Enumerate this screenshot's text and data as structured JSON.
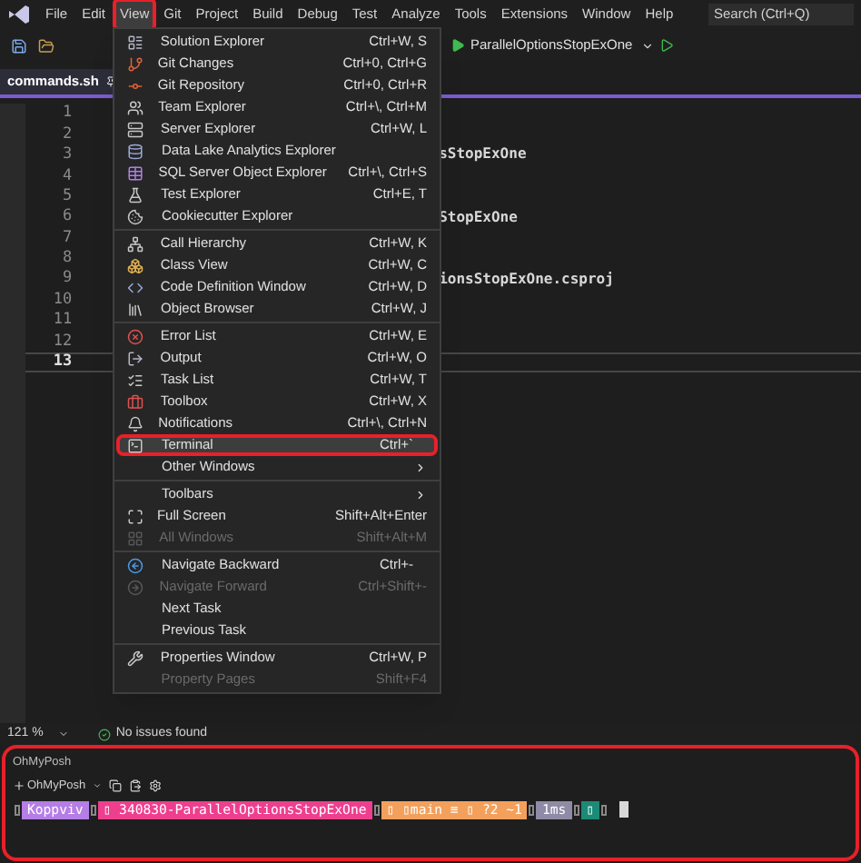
{
  "menu_bar": {
    "items": [
      {
        "label": "File",
        "selected": false
      },
      {
        "label": "Edit",
        "selected": false
      },
      {
        "label": "View",
        "selected": true
      },
      {
        "label": "Git",
        "selected": false
      },
      {
        "label": "Project",
        "selected": false
      },
      {
        "label": "Build",
        "selected": false
      },
      {
        "label": "Debug",
        "selected": false
      },
      {
        "label": "Test",
        "selected": false
      },
      {
        "label": "Analyze",
        "selected": false
      },
      {
        "label": "Tools",
        "selected": false
      },
      {
        "label": "Extensions",
        "selected": false
      },
      {
        "label": "Window",
        "selected": false
      },
      {
        "label": "Help",
        "selected": false
      }
    ]
  },
  "search": {
    "placeholder": "Search (Ctrl+Q)"
  },
  "toolbar": {
    "run_target": "ParallelOptionsStopExOne"
  },
  "editor_tab": {
    "label": "commands.sh"
  },
  "editor": {
    "lines": [
      {
        "number": "1",
        "current": false
      },
      {
        "number": "2",
        "current": false
      },
      {
        "number": "3",
        "current": false,
        "text": "sStopExOne"
      },
      {
        "number": "4",
        "current": false
      },
      {
        "number": "5",
        "current": false
      },
      {
        "number": "6",
        "current": false,
        "text": "StopExOne"
      },
      {
        "number": "7",
        "current": false
      },
      {
        "number": "8",
        "current": false
      },
      {
        "number": "9",
        "current": false,
        "text": "ionsStopExOne.csproj"
      },
      {
        "number": "10",
        "current": false
      },
      {
        "number": "11",
        "current": false
      },
      {
        "number": "12",
        "current": false
      },
      {
        "number": "13",
        "current": true
      }
    ]
  },
  "view_menu": {
    "groups": [
      [
        {
          "label": "Solution Explorer",
          "shortcut": "Ctrl+W, S",
          "disabled": false,
          "selected": false,
          "submenu": false
        },
        {
          "label": "Git Changes",
          "shortcut": "Ctrl+0, Ctrl+G",
          "disabled": false,
          "selected": false,
          "submenu": false
        },
        {
          "label": "Git Repository",
          "shortcut": "Ctrl+0, Ctrl+R",
          "disabled": false,
          "selected": false,
          "submenu": false
        },
        {
          "label": "Team Explorer",
          "shortcut": "Ctrl+\\, Ctrl+M",
          "disabled": false,
          "selected": false,
          "submenu": false
        },
        {
          "label": "Server Explorer",
          "shortcut": "Ctrl+W, L",
          "disabled": false,
          "selected": false,
          "submenu": false
        },
        {
          "label": "Data Lake Analytics Explorer",
          "disabled": false,
          "selected": false,
          "submenu": false
        },
        {
          "label": "SQL Server Object Explorer",
          "shortcut": "Ctrl+\\, Ctrl+S",
          "disabled": false,
          "selected": false,
          "submenu": false
        },
        {
          "label": "Test Explorer",
          "shortcut": "Ctrl+E, T",
          "disabled": false,
          "selected": false,
          "submenu": false
        },
        {
          "label": "Cookiecutter Explorer",
          "disabled": false,
          "selected": false,
          "submenu": false
        }
      ],
      [
        {
          "label": "Call Hierarchy",
          "shortcut": "Ctrl+W, K",
          "disabled": false,
          "selected": false,
          "submenu": false
        },
        {
          "label": "Class View",
          "shortcut": "Ctrl+W, C",
          "disabled": false,
          "selected": false,
          "submenu": false
        },
        {
          "label": "Code Definition Window",
          "shortcut": "Ctrl+W, D",
          "disabled": false,
          "selected": false,
          "submenu": false
        },
        {
          "label": "Object Browser",
          "shortcut": "Ctrl+W, J",
          "disabled": false,
          "selected": false,
          "submenu": false
        }
      ],
      [
        {
          "label": "Error List",
          "shortcut": "Ctrl+W, E",
          "disabled": false,
          "selected": false,
          "submenu": false
        },
        {
          "label": "Output",
          "shortcut": "Ctrl+W, O",
          "disabled": false,
          "selected": false,
          "submenu": false
        },
        {
          "label": "Task List",
          "shortcut": "Ctrl+W, T",
          "disabled": false,
          "selected": false,
          "submenu": false
        },
        {
          "label": "Toolbox",
          "shortcut": "Ctrl+W, X",
          "disabled": false,
          "selected": false,
          "submenu": false
        },
        {
          "label": "Notifications",
          "shortcut": "Ctrl+\\, Ctrl+N",
          "disabled": false,
          "selected": false,
          "submenu": false
        },
        {
          "label": "Terminal",
          "shortcut": "Ctrl+`",
          "disabled": false,
          "selected": true,
          "submenu": false
        },
        {
          "label": "Other Windows",
          "disabled": false,
          "selected": false,
          "submenu": true
        }
      ],
      [
        {
          "label": "Toolbars",
          "disabled": false,
          "selected": false,
          "submenu": true
        },
        {
          "label": "Full Screen",
          "shortcut": "Shift+Alt+Enter",
          "disabled": false,
          "selected": false,
          "submenu": false
        },
        {
          "label": "All Windows",
          "shortcut": "Shift+Alt+M",
          "disabled": true,
          "selected": false,
          "submenu": false
        }
      ],
      [
        {
          "label": "Navigate Backward",
          "shortcut": "Ctrl+-",
          "disabled": false,
          "selected": false,
          "submenu": false
        },
        {
          "label": "Navigate Forward",
          "shortcut": "Ctrl+Shift+-",
          "disabled": true,
          "selected": false,
          "submenu": false
        },
        {
          "label": "Next Task",
          "disabled": false,
          "selected": false,
          "submenu": false
        },
        {
          "label": "Previous Task",
          "disabled": false,
          "selected": false,
          "submenu": false
        }
      ],
      [
        {
          "label": "Properties Window",
          "shortcut": "Ctrl+W, P",
          "disabled": false,
          "selected": false,
          "submenu": false
        },
        {
          "label": "Property Pages",
          "shortcut": "Shift+F4",
          "disabled": true,
          "selected": false,
          "submenu": false
        }
      ]
    ]
  },
  "status_bar": {
    "zoom": "121 %",
    "issues": "No issues found"
  },
  "terminal": {
    "title": "OhMyPosh",
    "profile": "OhMyPosh",
    "prompt": [
      {
        "text": "Koppviv",
        "color": "#b57ee6"
      },
      {
        "text": "▯  340830-ParallelOptionsStopExOne",
        "color": "#ee3f8f"
      },
      {
        "text": "▯ ▯main ≡ ▯ ?2 ~1",
        "color": "#f3a05c"
      },
      {
        "text": "1ms",
        "color": "#8f8aa6"
      },
      {
        "text": "▯",
        "color": "#1b8a76"
      }
    ]
  }
}
